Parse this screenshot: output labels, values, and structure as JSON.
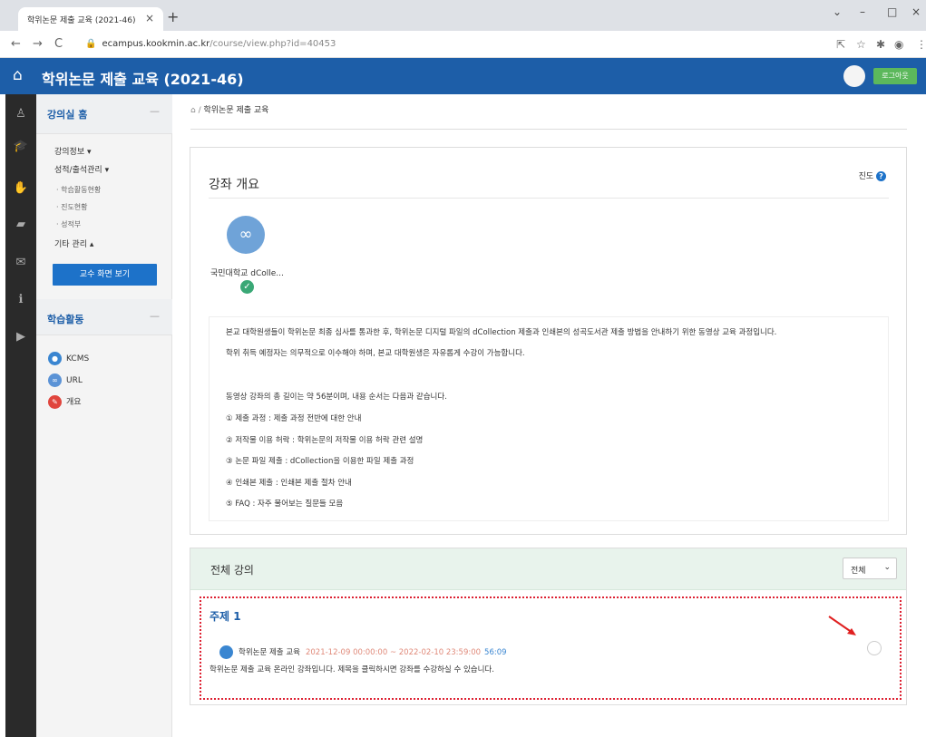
{
  "browser": {
    "tab_title": "학위논문 제출 교육 (2021-46)",
    "url_host": "ecampus.kookmin.ac.kr",
    "url_path": "/course/view.php?id=40453"
  },
  "header": {
    "title": "학위논문 제출 교육 (2021-46)",
    "logout": "로그아웃",
    "brand_color": "#1d5ea8"
  },
  "sidebar": {
    "course_home": "강의실 홈",
    "items": [
      "강의정보 ▾",
      "성적/출석관리 ▾"
    ],
    "sub_items": [
      "· 학습활동현황",
      "· 진도현황",
      "· 성적부"
    ],
    "other": "기타 관리 ▴",
    "prof_button": "교수 화면 보기",
    "activities_title": "학습활동",
    "activities": [
      {
        "label": "KCMS",
        "color": "#3a86d1"
      },
      {
        "label": "URL",
        "color": "#5b93d6"
      },
      {
        "label": "개요",
        "color": "#e0453d"
      }
    ]
  },
  "breadcrumb": "학위논문 제출 교육",
  "overview": {
    "title": "강좌 개요",
    "progress": "진도",
    "resource_label": "국민대학교 dColle...",
    "lines": [
      "본교 대학원생들이 학위논문 최종 심사를 통과한 후, 학위논문 디지털 파일의 dCollection 제출과 인쇄본의 성곡도서관 제출 방법을 안내하기 위한 동영상 교육 과정입니다.",
      "학위 취득 예정자는 의무적으로 이수해야 하며, 본교 대학원생은 자유롭게 수강이 가능합니다.",
      "동영상 강좌의 총 길이는 약 56분이며, 내용 순서는 다음과 같습니다.",
      "① 제출 과정 : 제출 과정 전반에 대한 안내",
      "② 저작물 이용 허락 : 학위논문의 저작물 이용 허락 관련 설명",
      "③ 논문 파일 제출 : dCollection을 이용한 파일 제출 과정",
      "④ 인쇄본 제출 : 인쇄본 제출 절차 안내",
      "⑤ FAQ : 자주 물어보는 질문들 모음"
    ]
  },
  "lectures": {
    "title": "전체 강의",
    "filter": "전체",
    "topic": "주제 1",
    "item_title": "학위논문 제출 교육",
    "item_dates": "2021-12-09 00:00:00 ~ 2022-02-10 23:59:00",
    "item_duration": "56:09",
    "item_desc": "학위논문 제출 교육 온라인 강좌입니다. 제목을 클릭하시면 강좌를 수강하실 수 있습니다."
  }
}
